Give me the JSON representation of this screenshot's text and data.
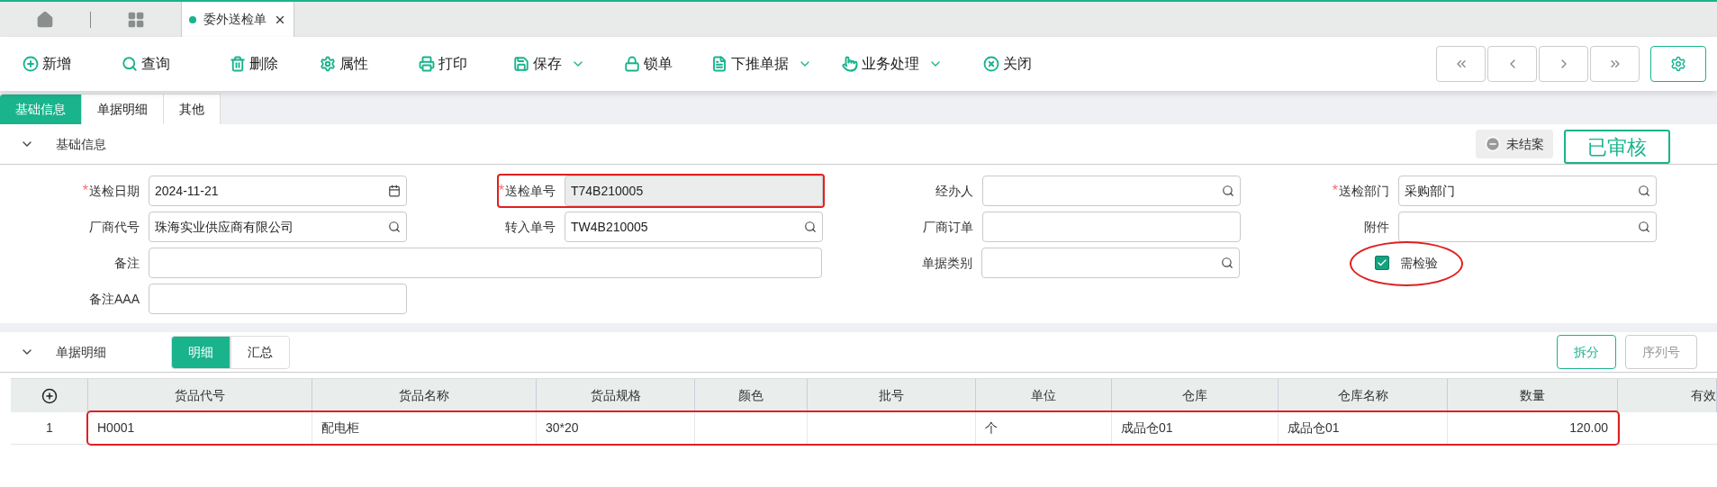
{
  "tabs": [
    {
      "label": "委外送检单",
      "selected": true
    }
  ],
  "toolbar": [
    {
      "label": "新增",
      "kind": "add",
      "dropdown": false
    },
    {
      "label": "查询",
      "kind": "search",
      "dropdown": false
    },
    {
      "label": "删除",
      "kind": "delete",
      "dropdown": false
    },
    {
      "label": "属性",
      "kind": "settings",
      "dropdown": false
    },
    {
      "label": "打印",
      "kind": "print",
      "dropdown": false
    },
    {
      "label": "保存",
      "kind": "save",
      "dropdown": true
    },
    {
      "label": "锁单",
      "kind": "lock",
      "dropdown": false
    },
    {
      "label": "下推单据",
      "kind": "document",
      "dropdown": true
    },
    {
      "label": "业务处理",
      "kind": "hand",
      "dropdown": true
    },
    {
      "label": "关闭",
      "kind": "close",
      "dropdown": false
    }
  ],
  "subtabs": [
    {
      "label": "基础信息",
      "selected": true
    },
    {
      "label": "单据明细",
      "selected": false
    },
    {
      "label": "其他",
      "selected": false
    }
  ],
  "basic_section": {
    "title": "基础信息",
    "expanded": true,
    "status": "未结案",
    "audit": "已审核"
  },
  "form_rows": [
    [
      {
        "kind": "date",
        "required_mark": "*",
        "label": "送检日期",
        "value": "2024-11-21",
        "readonly": false,
        "highlighted": false
      },
      {
        "kind": "text",
        "required_mark": "*",
        "label": "送检单号",
        "value": "T74B210005",
        "readonly": true,
        "highlighted": true
      },
      {
        "kind": "lookup",
        "label": "经办人",
        "readonly": false,
        "highlighted": false
      },
      {
        "kind": "lookup",
        "required_mark": "*",
        "label": "送检部门",
        "value": "采购部门",
        "readonly": false,
        "highlighted": false
      }
    ],
    [
      {
        "kind": "lookup",
        "label": "厂商代号",
        "value": "珠海实业供应商有限公司",
        "readonly": false,
        "highlighted": false
      },
      {
        "kind": "lookup",
        "label": "转入单号",
        "value": "TW4B210005",
        "readonly": false,
        "highlighted": false
      },
      {
        "kind": "text",
        "label": "厂商订单",
        "readonly": false,
        "highlighted": false
      },
      {
        "kind": "lookup",
        "label": "附件",
        "readonly": false,
        "highlighted": false
      }
    ],
    [
      {
        "kind": "long_text",
        "label": "备注",
        "readonly": false,
        "highlighted": false
      },
      {
        "kind": "lookup",
        "label": "单据类别",
        "readonly": false,
        "highlighted": false
      },
      {
        "kind": "checkbox",
        "label": "需检验",
        "checked": true,
        "highlighted": true
      }
    ],
    [
      {
        "kind": "text",
        "label": "备注AAA",
        "readonly": false,
        "highlighted": false
      }
    ]
  ],
  "detail_section": {
    "title": "单据明细",
    "expanded": true,
    "tabs": [
      {
        "label": "明细",
        "selected": true
      },
      {
        "label": "汇总",
        "selected": false
      }
    ],
    "buttons": [
      {
        "label": "拆分",
        "enabled": true
      },
      {
        "label": "序列号",
        "enabled": false
      }
    ]
  },
  "table": {
    "columns": [
      {
        "label": "货品代号",
        "numeric": false
      },
      {
        "label": "货品名称",
        "numeric": false
      },
      {
        "label": "货品规格",
        "numeric": false
      },
      {
        "label": "颜色",
        "numeric": false
      },
      {
        "label": "批号",
        "numeric": false
      },
      {
        "label": "单位",
        "numeric": false
      },
      {
        "label": "仓库",
        "numeric": false
      },
      {
        "label": "仓库名称",
        "numeric": false
      },
      {
        "label": "数量",
        "numeric": true
      },
      {
        "label": "有效",
        "numeric": false
      }
    ],
    "rows": [
      {
        "index": "1",
        "highlighted": true,
        "cells": [
          "H0001",
          "配电柜",
          "30*20",
          null,
          null,
          "个",
          "成品仓01",
          "成品仓01",
          "120.00",
          null
        ]
      }
    ]
  }
}
